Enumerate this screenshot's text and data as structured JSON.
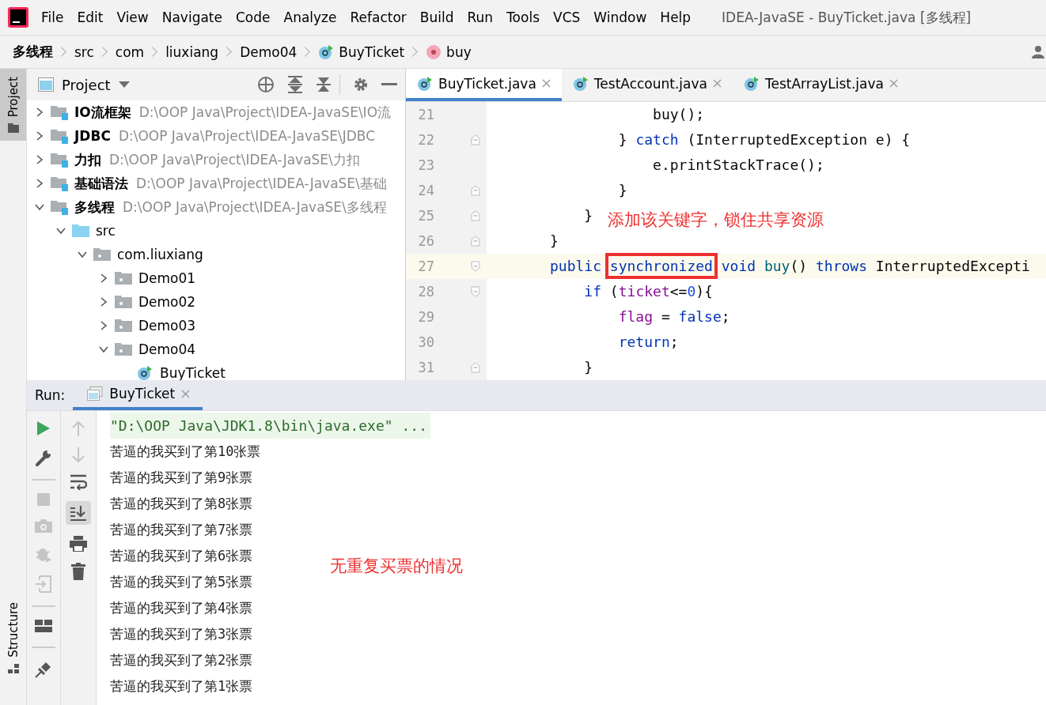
{
  "menu": [
    "File",
    "Edit",
    "View",
    "Navigate",
    "Code",
    "Analyze",
    "Refactor",
    "Build",
    "Run",
    "Tools",
    "VCS",
    "Window",
    "Help"
  ],
  "window": {
    "title": "IDEA-JavaSE - BuyTicket.java [多线程]"
  },
  "breadcrumb": [
    {
      "label": "多线程",
      "kind": "module"
    },
    {
      "label": "src",
      "kind": "folder"
    },
    {
      "label": "com",
      "kind": "folder"
    },
    {
      "label": "liuxiang",
      "kind": "folder"
    },
    {
      "label": "Demo04",
      "kind": "folder"
    },
    {
      "label": "BuyTicket",
      "kind": "class"
    },
    {
      "label": "buy",
      "kind": "method"
    }
  ],
  "left_stripe": {
    "top": "Project",
    "bottom": "Structure"
  },
  "project_panel": {
    "title": "Project"
  },
  "tree": [
    {
      "label": "IO流框架",
      "path": "D:\\OOP Java\\Project\\IDEA-JavaSE\\IO流",
      "kind": "module",
      "expanded": false
    },
    {
      "label": "JDBC",
      "path": "D:\\OOP Java\\Project\\IDEA-JavaSE\\JDBC",
      "kind": "module",
      "expanded": false
    },
    {
      "label": "力扣",
      "path": "D:\\OOP Java\\Project\\IDEA-JavaSE\\力扣",
      "kind": "module",
      "expanded": false
    },
    {
      "label": "基础语法",
      "path": "D:\\OOP Java\\Project\\IDEA-JavaSE\\基础",
      "kind": "module",
      "expanded": false
    },
    {
      "label": "多线程",
      "path": "D:\\OOP Java\\Project\\IDEA-JavaSE\\多线程",
      "kind": "module",
      "expanded": true,
      "children": [
        {
          "label": "src",
          "kind": "source",
          "expanded": true,
          "children": [
            {
              "label": "com.liuxiang",
              "kind": "package",
              "expanded": true,
              "children": [
                {
                  "label": "Demo01",
                  "kind": "package",
                  "expanded": false
                },
                {
                  "label": "Demo02",
                  "kind": "package",
                  "expanded": false
                },
                {
                  "label": "Demo03",
                  "kind": "package",
                  "expanded": false
                },
                {
                  "label": "Demo04",
                  "kind": "package",
                  "expanded": true,
                  "children": [
                    {
                      "label": "BuyTicket",
                      "kind": "class"
                    }
                  ]
                }
              ]
            }
          ]
        }
      ]
    }
  ],
  "editor_tabs": [
    {
      "label": "BuyTicket.java",
      "selected": true
    },
    {
      "label": "TestAccount.java",
      "selected": false
    },
    {
      "label": "TestArrayList.java",
      "selected": false
    }
  ],
  "code": [
    {
      "number": "21",
      "current": false,
      "kind": "plain",
      "tokens": [
        {
          "kind": "plain",
          "text": "            buy();"
        }
      ]
    },
    {
      "number": "22",
      "current": false,
      "kind": "fold-end",
      "tokens": [
        {
          "kind": "plain",
          "text": "        } "
        },
        {
          "kind": "keyword",
          "text": "catch"
        },
        {
          "kind": "plain",
          "text": " (InterruptedException e) {"
        }
      ]
    },
    {
      "number": "23",
      "current": false,
      "kind": "plain",
      "tokens": [
        {
          "kind": "plain",
          "text": "            e.printStackTrace();"
        }
      ]
    },
    {
      "number": "24",
      "current": false,
      "kind": "fold-end",
      "tokens": [
        {
          "kind": "plain",
          "text": "        }"
        }
      ]
    },
    {
      "number": "25",
      "current": false,
      "kind": "fold-end",
      "tokens": [
        {
          "kind": "plain",
          "text": "    }"
        }
      ]
    },
    {
      "number": "26",
      "current": false,
      "kind": "fold-end",
      "tokens": [
        {
          "kind": "plain",
          "text": "}"
        }
      ]
    },
    {
      "number": "27",
      "current": true,
      "kind": "fold-start",
      "tokens": [
        {
          "kind": "keyword",
          "text": "public "
        },
        {
          "kind": "keyword",
          "text": "synchronized",
          "boxed": true
        },
        {
          "kind": "keyword",
          "text": " void "
        },
        {
          "kind": "method",
          "text": "buy"
        },
        {
          "kind": "plain",
          "text": "() "
        },
        {
          "kind": "keyword",
          "text": "throws"
        },
        {
          "kind": "plain",
          "text": " InterruptedExcepti"
        }
      ]
    },
    {
      "number": "28",
      "current": false,
      "kind": "fold-start",
      "tokens": [
        {
          "kind": "keyword",
          "text": "    if"
        },
        {
          "kind": "plain",
          "text": " ("
        },
        {
          "kind": "field",
          "text": "ticket"
        },
        {
          "kind": "plain",
          "text": "<="
        },
        {
          "kind": "number",
          "text": "0"
        },
        {
          "kind": "plain",
          "text": "){"
        }
      ]
    },
    {
      "number": "29",
      "current": false,
      "kind": "plain",
      "tokens": [
        {
          "kind": "field",
          "text": "        flag"
        },
        {
          "kind": "plain",
          "text": " = "
        },
        {
          "kind": "keyword",
          "text": "false"
        },
        {
          "kind": "plain",
          "text": ";"
        }
      ]
    },
    {
      "number": "30",
      "current": false,
      "kind": "plain",
      "tokens": [
        {
          "kind": "keyword",
          "text": "        return"
        },
        {
          "kind": "plain",
          "text": ";"
        }
      ]
    },
    {
      "number": "31",
      "current": false,
      "kind": "fold-end",
      "tokens": [
        {
          "kind": "plain",
          "text": "    }"
        }
      ]
    }
  ],
  "editor_note": "添加该关键字，锁住共享资源",
  "run_panel": {
    "label": "Run:",
    "tab": "BuyTicket"
  },
  "console": [
    {
      "kind": "command",
      "text": "\"D:\\OOP Java\\JDK1.8\\bin\\java.exe\" ..."
    },
    {
      "kind": "output",
      "text": "苦逼的我买到了第10张票"
    },
    {
      "kind": "output",
      "text": "苦逼的我买到了第9张票"
    },
    {
      "kind": "output",
      "text": "苦逼的我买到了第8张票"
    },
    {
      "kind": "output",
      "text": "苦逼的我买到了第7张票"
    },
    {
      "kind": "output",
      "text": "苦逼的我买到了第6张票"
    },
    {
      "kind": "output",
      "text": "苦逼的我买到了第5张票"
    },
    {
      "kind": "output",
      "text": "苦逼的我买到了第4张票"
    },
    {
      "kind": "output",
      "text": "苦逼的我买到了第3张票"
    },
    {
      "kind": "output",
      "text": "苦逼的我买到了第2张票"
    },
    {
      "kind": "output",
      "text": "苦逼的我买到了第1张票"
    }
  ],
  "console_note": "无重复买票的情况"
}
